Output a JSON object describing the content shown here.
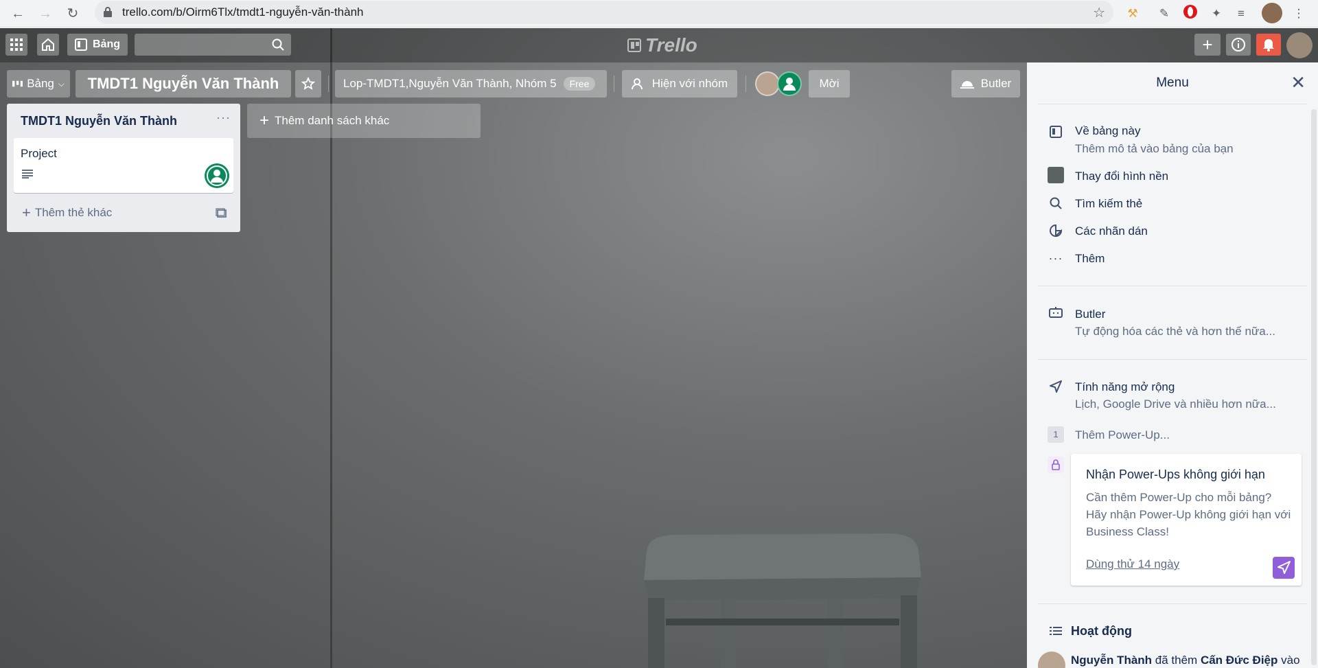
{
  "browser": {
    "url": "trello.com/b/Oirm6Tlx/tmdt1-nguyễn-văn-thành"
  },
  "header": {
    "boards_label": "Bảng",
    "logo_text": "Trello"
  },
  "board": {
    "switcher_label": "Bảng",
    "title": "TMDT1 Nguyễn Văn Thành",
    "team": "Lop-TMDT1,Nguyễn Văn Thành, Nhóm 5",
    "plan": "Free",
    "visibility": "Hiện với nhóm",
    "invite": "Mời",
    "butler": "Butler"
  },
  "lists": [
    {
      "title": "TMDT1 Nguyễn Văn Thành",
      "cards": [
        {
          "title": "Project"
        }
      ],
      "add_card_label": "Thêm thẻ khác"
    }
  ],
  "add_list_label": "Thêm danh sách khác",
  "menu": {
    "title": "Menu",
    "items": [
      {
        "label": "Về bảng này",
        "sub": "Thêm mô tả vào bảng của bạn"
      },
      {
        "label": "Thay đổi hình nền"
      },
      {
        "label": "Tìm kiếm thẻ"
      },
      {
        "label": "Các nhãn dán"
      },
      {
        "label": "Thêm"
      }
    ],
    "butler": {
      "label": "Butler",
      "sub": "Tự động hóa các thẻ và hơn thế nữa..."
    },
    "powerups": {
      "label": "Tính năng mở rộng",
      "sub": "Lịch, Google Drive và nhiều hơn nữa...",
      "count": "1",
      "add_label": "Thêm Power-Up..."
    },
    "promo": {
      "title": "Nhận Power-Ups không giới hạn",
      "body": "Cần thêm Power-Up cho mỗi bảng? Hãy nhận Power-Up không giới hạn với Business Class!",
      "link": "Dùng thử 14 ngày"
    },
    "activity": {
      "title": "Hoạt động",
      "entry": {
        "actor": "Nguyễn Thành",
        "action": " đã thêm ",
        "target": "Cấn Đức Điệp",
        "tail": " vào"
      }
    }
  },
  "colors": {
    "bell": "#eb5a46",
    "list_bg": "#ebecf0",
    "menu_bg": "#f4f5f7",
    "promo_accent": "#8f5ed8",
    "avatar_green": "#0a8a5a"
  }
}
